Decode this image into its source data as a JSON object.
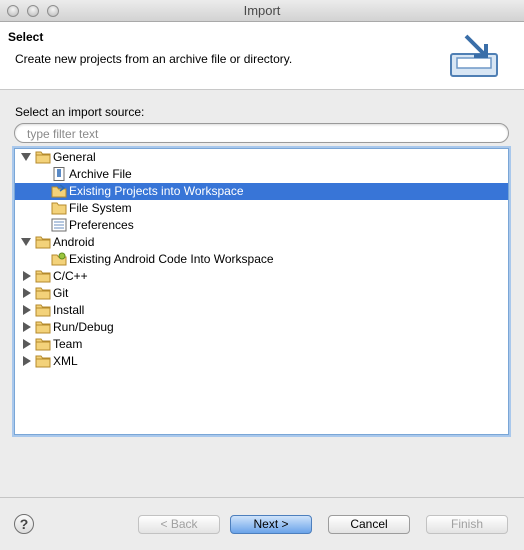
{
  "window": {
    "title": "Import"
  },
  "header": {
    "title": "Select",
    "description": "Create new projects from an archive file or directory."
  },
  "source": {
    "label": "Select an import source:",
    "filter_placeholder": "type filter text"
  },
  "tree": {
    "items": [
      {
        "label": "General",
        "expanded": true,
        "icon": "folder-icon"
      },
      {
        "label": "Archive File",
        "icon": "archive-file-icon"
      },
      {
        "label": "Existing Projects into Workspace",
        "icon": "import-projects-icon",
        "selected": true
      },
      {
        "label": "File System",
        "icon": "folder-icon"
      },
      {
        "label": "Preferences",
        "icon": "preferences-icon"
      },
      {
        "label": "Android",
        "expanded": true,
        "icon": "folder-icon"
      },
      {
        "label": "Existing Android Code Into Workspace",
        "icon": "import-android-icon"
      },
      {
        "label": "C/C++",
        "expanded": false,
        "icon": "folder-icon"
      },
      {
        "label": "Git",
        "expanded": false,
        "icon": "folder-icon"
      },
      {
        "label": "Install",
        "expanded": false,
        "icon": "folder-icon"
      },
      {
        "label": "Run/Debug",
        "expanded": false,
        "icon": "folder-icon"
      },
      {
        "label": "Team",
        "expanded": false,
        "icon": "folder-icon"
      },
      {
        "label": "XML",
        "expanded": false,
        "icon": "folder-icon"
      }
    ]
  },
  "buttons": {
    "back": "< Back",
    "next": "Next >",
    "cancel": "Cancel",
    "finish": "Finish",
    "help": "?"
  },
  "colors": {
    "selection": "#3875d7",
    "default_button": "#6aa3e9"
  }
}
